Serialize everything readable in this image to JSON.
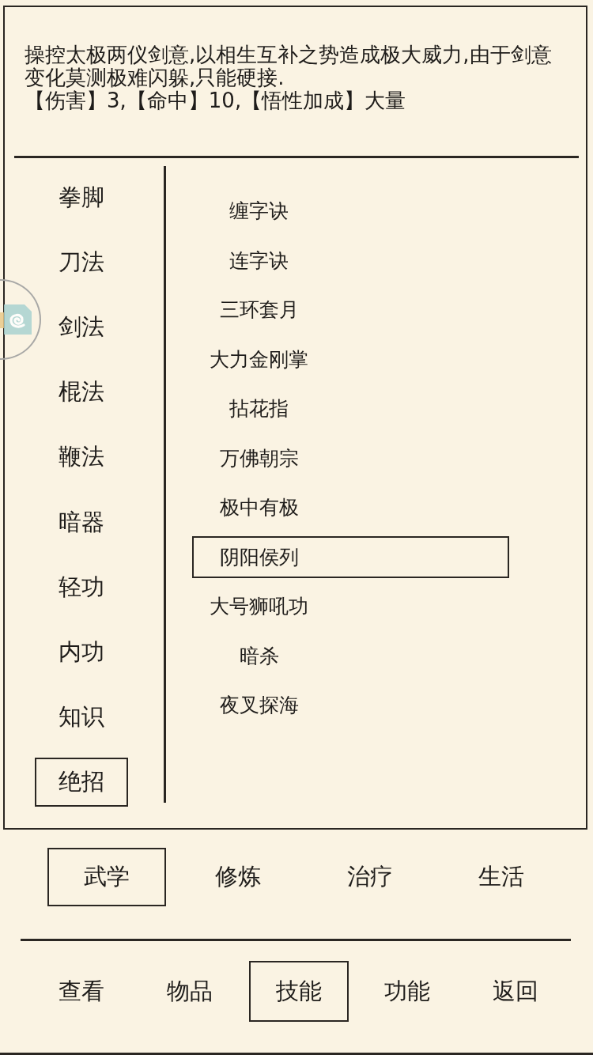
{
  "description": {
    "text": "操控太极两仪剑意,以相生互补之势造成极大威力,由于剑意变化莫测极难闪躲,只能硬接.",
    "stats": "【伤害】3,【命中】10,【悟性加成】大量"
  },
  "categories": [
    {
      "label": "拳脚",
      "selected": false
    },
    {
      "label": "刀法",
      "selected": false
    },
    {
      "label": "剑法",
      "selected": false
    },
    {
      "label": "棍法",
      "selected": false
    },
    {
      "label": "鞭法",
      "selected": false
    },
    {
      "label": "暗器",
      "selected": false
    },
    {
      "label": "轻功",
      "selected": false
    },
    {
      "label": "内功",
      "selected": false
    },
    {
      "label": "知识",
      "selected": false
    },
    {
      "label": "绝招",
      "selected": true
    }
  ],
  "skills": [
    {
      "label": "缠字诀",
      "selected": false
    },
    {
      "label": "连字诀",
      "selected": false
    },
    {
      "label": "三环套月",
      "selected": false
    },
    {
      "label": "大力金刚掌",
      "selected": false
    },
    {
      "label": "拈花指",
      "selected": false
    },
    {
      "label": "万佛朝宗",
      "selected": false
    },
    {
      "label": "极中有极",
      "selected": false
    },
    {
      "label": "阴阳侯列",
      "selected": true
    },
    {
      "label": "大号狮吼功",
      "selected": false
    },
    {
      "label": "暗杀",
      "selected": false
    },
    {
      "label": "夜叉探海",
      "selected": false
    }
  ],
  "tabs": [
    {
      "label": "武学",
      "selected": true
    },
    {
      "label": "修炼",
      "selected": false
    },
    {
      "label": "治疗",
      "selected": false
    },
    {
      "label": "生活",
      "selected": false
    }
  ],
  "nav": [
    {
      "label": "查看",
      "selected": false
    },
    {
      "label": "物品",
      "selected": false
    },
    {
      "label": "技能",
      "selected": true
    },
    {
      "label": "功能",
      "selected": false
    },
    {
      "label": "返回",
      "selected": false
    }
  ]
}
